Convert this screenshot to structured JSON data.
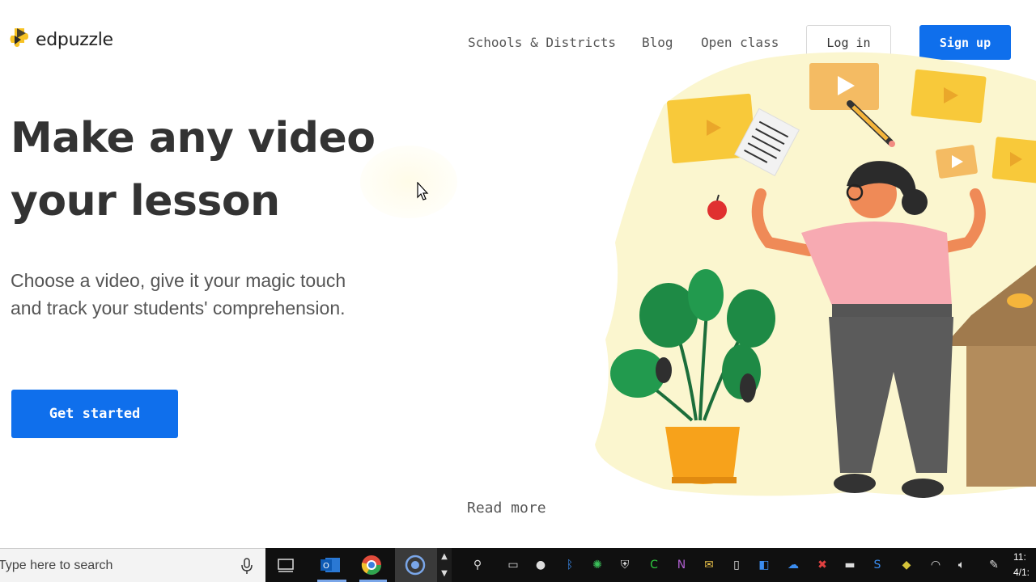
{
  "brand": {
    "name": "edpuzzle",
    "logo_color": "#f7c223"
  },
  "nav": {
    "links": [
      "Schools & Districts",
      "Blog",
      "Open class"
    ],
    "login_label": "Log in",
    "signup_label": "Sign up"
  },
  "hero": {
    "headline_line1": "Make any video",
    "headline_line2": "your lesson",
    "subtext": "Choose a video, give it your magic touch and track your students' comprehension.",
    "cta_label": "Get started",
    "read_more": "Read more",
    "accent_color": "#0f6fec"
  },
  "taskbar": {
    "search_placeholder": "Type here to search",
    "clock_time": "11:",
    "clock_date": "4/1:"
  }
}
